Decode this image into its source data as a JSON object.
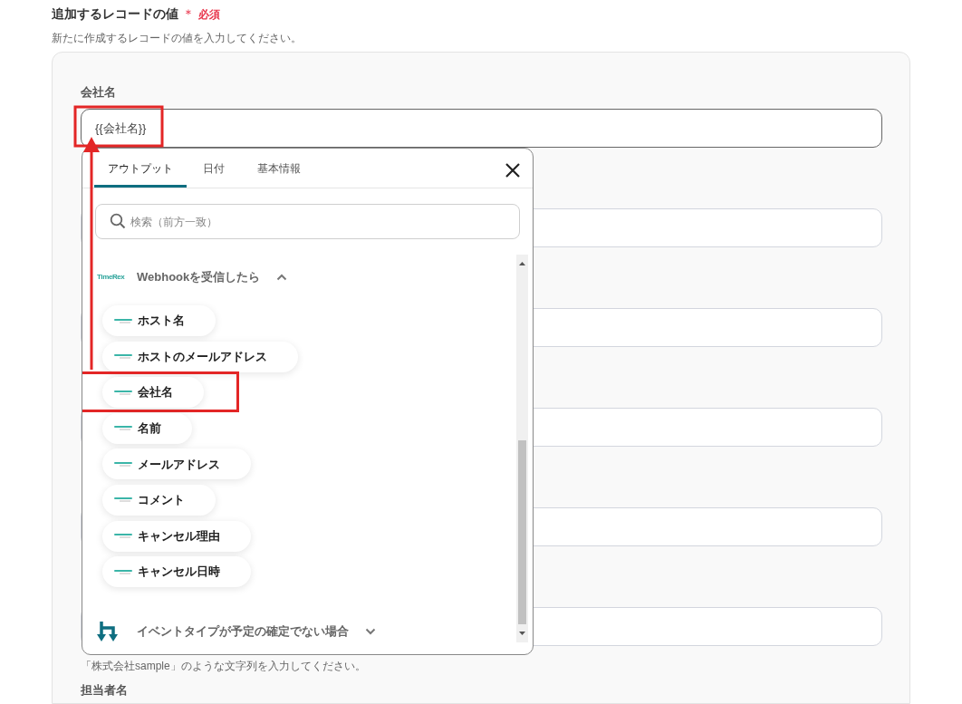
{
  "section": {
    "title": "追加するレコードの値",
    "required_mark": "＊",
    "required_label": "必須",
    "description": "新たに作成するレコードの値を入力してください。"
  },
  "form": {
    "fields": [
      {
        "label": "会社名",
        "value": "{{会社名}}",
        "focused": true
      },
      {
        "focused": false
      },
      {
        "focused": false
      },
      {
        "focused": false
      },
      {
        "focused": false
      },
      {
        "focused": false
      }
    ],
    "hint": "「株式会社sample」のような文字列を入力してください。",
    "next_label": "担当者名"
  },
  "popup": {
    "tabs": [
      {
        "label": "アウトプット",
        "selected": true
      },
      {
        "label": "日付",
        "selected": false
      },
      {
        "label": "基本情報",
        "selected": false
      }
    ],
    "search": {
      "placeholder": "検索（前方一致）"
    },
    "groups": [
      {
        "kind": "timerex",
        "logo_text": "TimeRex",
        "title": "Webhookを受信したら",
        "expanded": true,
        "items": [
          {
            "label": "ホスト名",
            "highlighted": false
          },
          {
            "label": "ホストのメールアドレス",
            "highlighted": false
          },
          {
            "label": "会社名",
            "highlighted": true
          },
          {
            "label": "名前",
            "highlighted": false
          },
          {
            "label": "メールアドレス",
            "highlighted": false
          },
          {
            "label": "コメント",
            "highlighted": false
          },
          {
            "label": "キャンセル理由",
            "highlighted": false
          },
          {
            "label": "キャンセル日時",
            "highlighted": false
          }
        ]
      },
      {
        "kind": "branch",
        "title": "イベントタイプが予定の確定でない場合",
        "expanded": false
      }
    ]
  }
}
